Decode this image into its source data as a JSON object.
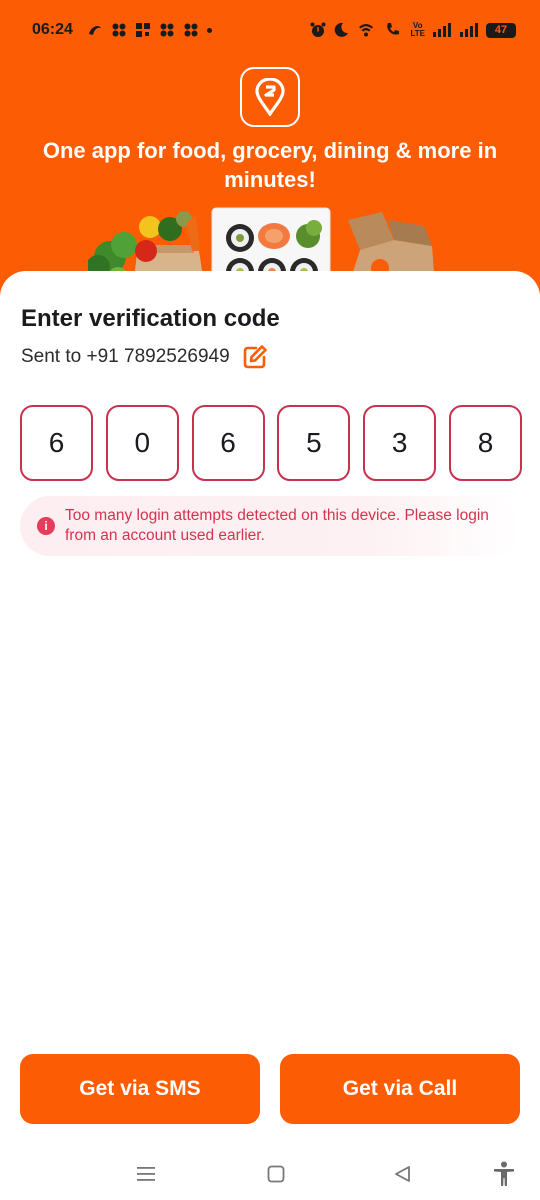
{
  "status_bar": {
    "time": "06:24",
    "volte_label": "Vo",
    "lte_label": "LTE",
    "battery": "47"
  },
  "hero": {
    "tagline": "One app for food, grocery, dining & more in minutes!",
    "logo_icon": "swiggy-logo-icon",
    "accent_color": "#fc5c04"
  },
  "verification": {
    "title": "Enter verification code",
    "sent_to": "Sent to +91 7892526949",
    "otp_digits": [
      "6",
      "0",
      "6",
      "5",
      "3",
      "8"
    ],
    "error_message": "Too many login attempts detected on this device. Please login from an account used earlier.",
    "error_color": "#d6334f"
  },
  "actions": {
    "sms_label": "Get via SMS",
    "call_label": "Get via Call"
  },
  "nav": {
    "icons": [
      "menu-icon",
      "home-square-icon",
      "back-triangle-icon",
      "accessibility-icon"
    ]
  }
}
